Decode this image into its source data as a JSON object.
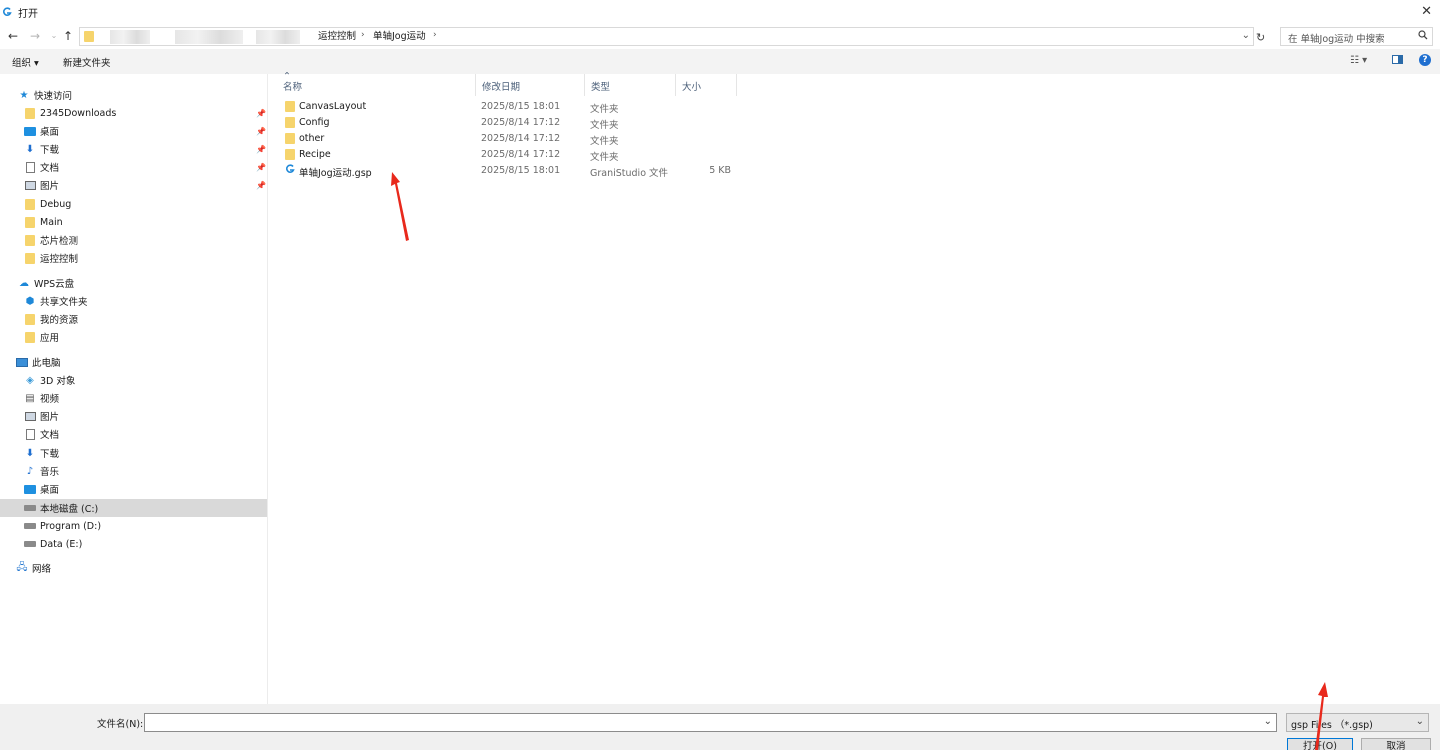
{
  "window": {
    "title": "打开",
    "close_icon": "close-icon"
  },
  "address": {
    "breadcrumbs": [
      "运控控制",
      "单轴Jog运动"
    ],
    "search_placeholder": "在 单轴Jog运动 中搜索"
  },
  "toolbar": {
    "organize_label": "组织",
    "new_folder_label": "新建文件夹"
  },
  "nav": {
    "quick_access": {
      "label": "快速访问",
      "items": [
        {
          "label": "2345Downloads",
          "icon": "folder-icon",
          "pinned": true
        },
        {
          "label": "桌面",
          "icon": "desktop-icon",
          "pinned": true
        },
        {
          "label": "下载",
          "icon": "download-icon",
          "pinned": true
        },
        {
          "label": "文档",
          "icon": "document-icon",
          "pinned": true
        },
        {
          "label": "图片",
          "icon": "picture-icon",
          "pinned": true
        },
        {
          "label": "Debug",
          "icon": "folder-icon",
          "pinned": false
        },
        {
          "label": "Main",
          "icon": "folder-icon",
          "pinned": false
        },
        {
          "label": "芯片检测",
          "icon": "folder-icon",
          "pinned": false
        },
        {
          "label": "运控控制",
          "icon": "folder-icon",
          "pinned": false
        }
      ]
    },
    "wps": {
      "label": "WPS云盘",
      "items": [
        {
          "label": "共享文件夹",
          "icon": "share-icon"
        },
        {
          "label": "我的资源",
          "icon": "folder-icon"
        },
        {
          "label": "应用",
          "icon": "folder-icon"
        }
      ]
    },
    "this_pc": {
      "label": "此电脑",
      "items": [
        {
          "label": "3D 对象",
          "icon": "3d-objects-icon"
        },
        {
          "label": "视频",
          "icon": "video-icon"
        },
        {
          "label": "图片",
          "icon": "picture-icon"
        },
        {
          "label": "文档",
          "icon": "document-icon"
        },
        {
          "label": "下载",
          "icon": "download-icon"
        },
        {
          "label": "音乐",
          "icon": "music-icon"
        },
        {
          "label": "桌面",
          "icon": "desktop-icon"
        },
        {
          "label": "本地磁盘 (C:)",
          "icon": "drive-icon",
          "selected": true
        },
        {
          "label": "Program (D:)",
          "icon": "drive-icon"
        },
        {
          "label": "Data (E:)",
          "icon": "drive-icon"
        }
      ]
    },
    "network": {
      "label": "网络"
    }
  },
  "columns": {
    "name": "名称",
    "date": "修改日期",
    "type": "类型",
    "size": "大小"
  },
  "files": [
    {
      "name": "CanvasLayout",
      "date": "2025/8/15 18:01",
      "type": "文件夹",
      "size": "",
      "icon": "folder-icon"
    },
    {
      "name": "Config",
      "date": "2025/8/14 17:12",
      "type": "文件夹",
      "size": "",
      "icon": "folder-icon"
    },
    {
      "name": "other",
      "date": "2025/8/14 17:12",
      "type": "文件夹",
      "size": "",
      "icon": "folder-icon"
    },
    {
      "name": "Recipe",
      "date": "2025/8/14 17:12",
      "type": "文件夹",
      "size": "",
      "icon": "folder-icon"
    },
    {
      "name": "单轴Jog运动.gsp",
      "date": "2025/8/15 18:01",
      "type": "GraniStudio 文件",
      "size": "5 KB",
      "icon": "gsp-file-icon"
    }
  ],
  "bottom": {
    "filename_label": "文件名(N):",
    "filename_value": "",
    "filetype_value": "gsp Files （*.gsp)",
    "open_label": "打开(O)",
    "cancel_label": "取消"
  },
  "colors": {
    "accent": "#0078d7",
    "annotation_arrow": "#e8291c",
    "folder": "#f6d46c"
  }
}
